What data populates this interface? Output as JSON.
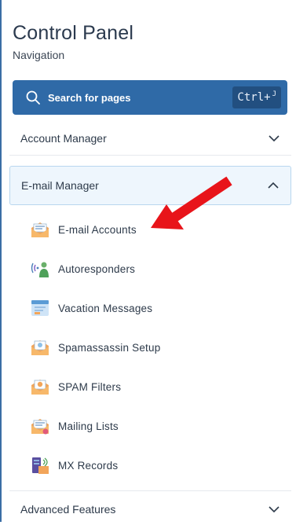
{
  "header": {
    "title": "Control Panel",
    "subtitle": "Navigation"
  },
  "search": {
    "placeholder": "Search for pages",
    "shortcut": "Ctrl+",
    "shortcut_small": "J"
  },
  "sections": [
    {
      "label": "Account Manager",
      "expanded": false
    },
    {
      "label": "E-mail Manager",
      "expanded": true
    },
    {
      "label": "Advanced Features",
      "expanded": false
    }
  ],
  "email_items": [
    {
      "label": "E-mail Accounts",
      "icon": "envelope-icon"
    },
    {
      "label": "Autoresponders",
      "icon": "autoresponder-icon"
    },
    {
      "label": "Vacation Messages",
      "icon": "vacation-message-icon"
    },
    {
      "label": "Spamassassin Setup",
      "icon": "spamassassin-icon"
    },
    {
      "label": "SPAM Filters",
      "icon": "spam-filter-icon"
    },
    {
      "label": "Mailing Lists",
      "icon": "mailing-list-icon"
    },
    {
      "label": "MX Records",
      "icon": "mx-records-icon"
    }
  ],
  "colors": {
    "accent": "#2f6aa7",
    "expanded_bg": "#eef6fd",
    "arrow": "#e8141a"
  }
}
